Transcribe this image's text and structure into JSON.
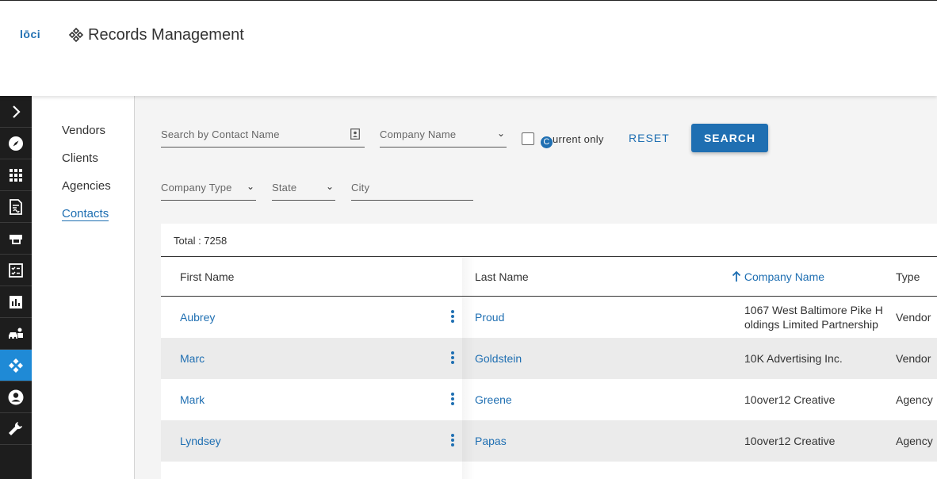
{
  "header": {
    "logo": "lōci",
    "title": "Records Management"
  },
  "rail": {
    "items": [
      {
        "name": "expand",
        "icon": "chevron-right-icon"
      },
      {
        "name": "explore",
        "icon": "compass-icon"
      },
      {
        "name": "apps",
        "icon": "grid-icon"
      },
      {
        "name": "contracts",
        "icon": "document-icon"
      },
      {
        "name": "printer",
        "icon": "printer-icon"
      },
      {
        "name": "tasks",
        "icon": "checklist-icon"
      },
      {
        "name": "reports",
        "icon": "bar-chart-icon"
      },
      {
        "name": "transport",
        "icon": "vehicles-icon"
      },
      {
        "name": "records",
        "icon": "records-icon",
        "active": true
      },
      {
        "name": "account",
        "icon": "user-icon"
      },
      {
        "name": "tools",
        "icon": "wrench-icon"
      }
    ]
  },
  "subnav": {
    "items": [
      {
        "label": "Vendors"
      },
      {
        "label": "Clients"
      },
      {
        "label": "Agencies"
      },
      {
        "label": "Contacts",
        "active": true
      }
    ]
  },
  "filters": {
    "contact_search_placeholder": "Search by Contact Name",
    "company_name": "Company Name",
    "current_only_label": "urrent only",
    "current_only_cursor": "C",
    "current_only_checked": false,
    "reset_label": "RESET",
    "search_label": "SEARCH",
    "company_type": "Company Type",
    "state": "State",
    "city_placeholder": "City"
  },
  "table": {
    "total_label": "Total : 7258",
    "columns": {
      "first_name": "First Name",
      "last_name": "Last Name",
      "company_name": "Company Name",
      "type": "Type"
    },
    "sort": {
      "column": "company_name",
      "direction": "ascending"
    },
    "rows": [
      {
        "first": "Aubrey",
        "last": "Proud",
        "company_line1": "1067 West Baltimore Pike H",
        "company_line2": "oldings Limited Partnership",
        "type": "Vendor"
      },
      {
        "first": "Marc",
        "last": "Goldstein",
        "company_line1": "10K Advertising Inc.",
        "company_line2": "",
        "type": "Vendor"
      },
      {
        "first": "Mark",
        "last": "Greene",
        "company_line1": "10over12 Creative",
        "company_line2": "",
        "type": "Agency"
      },
      {
        "first": "Lyndsey",
        "last": "Papas",
        "company_line1": "10over12 Creative",
        "company_line2": "",
        "type": "Agency"
      }
    ]
  },
  "colors": {
    "accent": "#1f6fb2",
    "rail_bg": "#1d1d1d",
    "rail_active": "#1f8ad6"
  }
}
